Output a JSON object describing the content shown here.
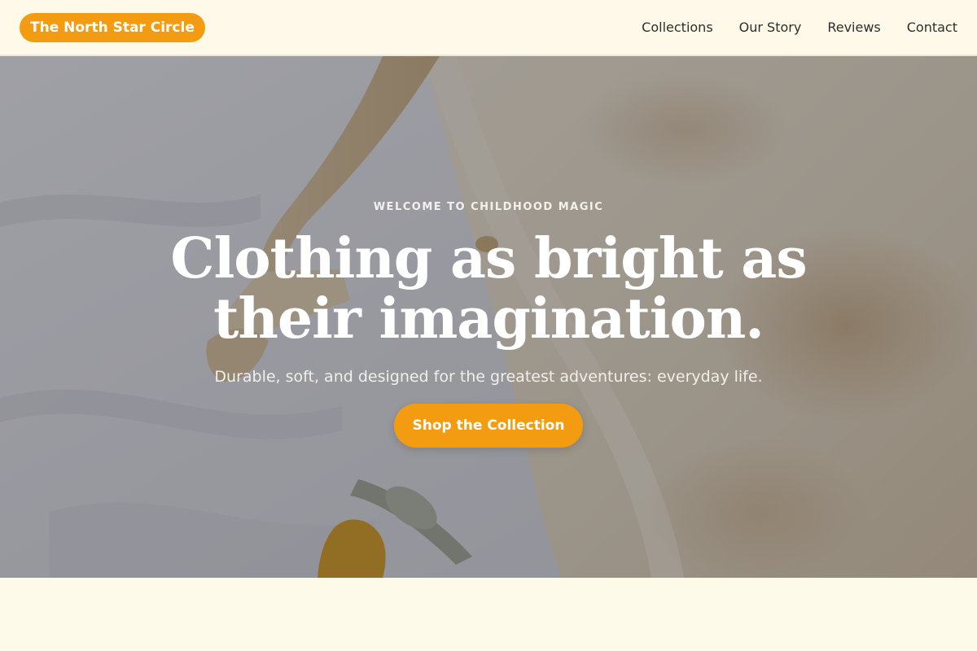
{
  "header": {
    "brand": "The North Star Circle",
    "nav": [
      {
        "label": "Collections"
      },
      {
        "label": "Our Story"
      },
      {
        "label": "Reviews"
      },
      {
        "label": "Contact"
      }
    ]
  },
  "hero": {
    "eyebrow": "WELCOME TO CHILDHOOD MAGIC",
    "headline_line1": "Clothing as bright as",
    "headline_line2": "their imagination.",
    "subhead": "Durable, soft, and designed for the greatest adventures: everyday life.",
    "cta_label": "Shop the Collection"
  },
  "colors": {
    "accent": "#f39c12",
    "page_background": "#fef9e8",
    "nav_text": "#2d2d2d",
    "hero_text": "#ffffff"
  }
}
